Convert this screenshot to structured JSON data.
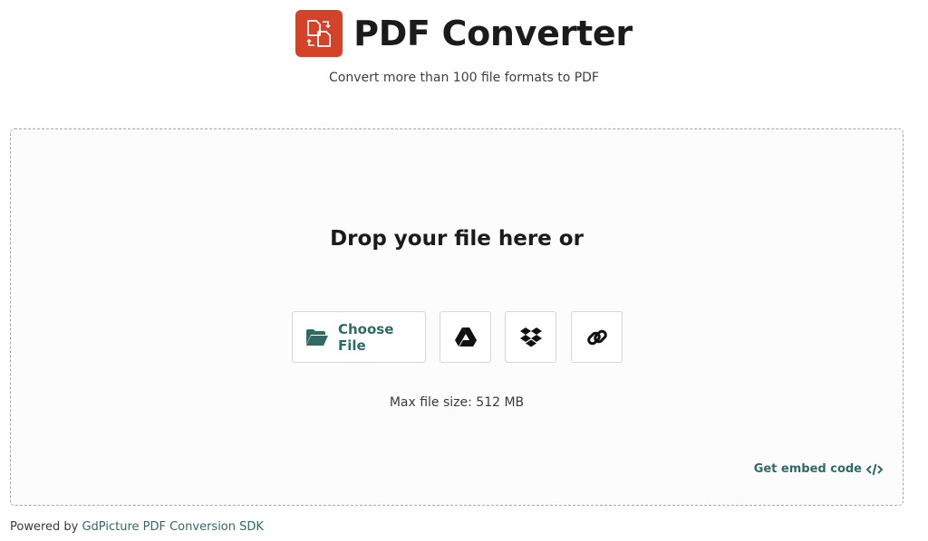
{
  "header": {
    "title": "PDF Converter",
    "subtitle": "Convert more than 100 file formats to PDF",
    "logo_icon": "file-convert-icon",
    "logo_color": "#d4422a"
  },
  "dropzone": {
    "heading": "Drop your file here or",
    "choose_file_label": "Choose File",
    "choose_file_icon": "folder-open-icon",
    "sources": [
      {
        "name": "google-drive",
        "icon": "google-drive-icon"
      },
      {
        "name": "dropbox",
        "icon": "dropbox-icon"
      },
      {
        "name": "url",
        "icon": "link-icon"
      }
    ],
    "max_size": "Max file size: 512 MB",
    "embed_label": "Get embed code",
    "embed_icon": "code-icon"
  },
  "footer": {
    "prefix": "Powered by",
    "link_text": "GdPicture PDF Conversion SDK"
  },
  "colors": {
    "accent": "#2f6a66",
    "brand": "#d4422a"
  }
}
